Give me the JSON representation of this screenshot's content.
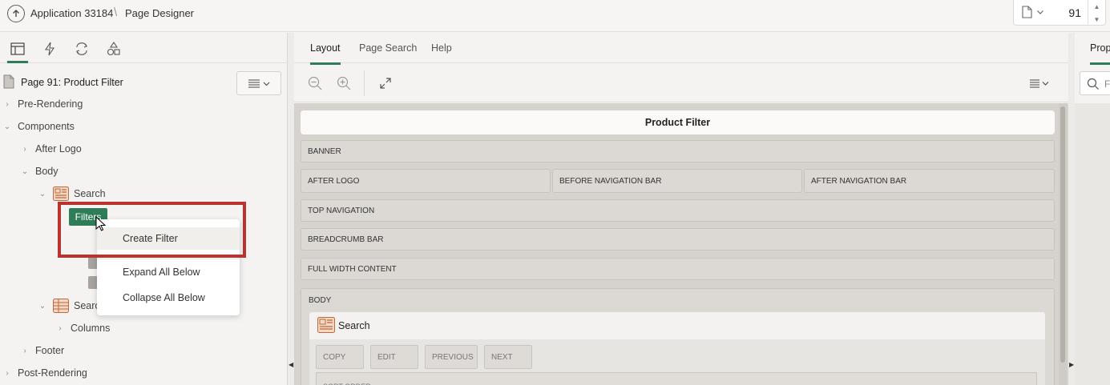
{
  "header": {
    "app_crumb": "Application 33184",
    "separator": "\\",
    "page_crumb": "Page Designer",
    "page_number": "91"
  },
  "left_panel": {
    "tabs": [
      "rendering-tab",
      "dynamic-actions-tab",
      "processing-tab",
      "shared-components-tab"
    ],
    "page_title": "Page 91: Product Filter",
    "tree": {
      "pre_rendering": "Pre-Rendering",
      "components": "Components",
      "after_logo": "After Logo",
      "body": "Body",
      "search": "Search",
      "filters": "Filters",
      "search2": "Searc",
      "columns": "Columns",
      "footer": "Footer",
      "post_rendering": "Post-Rendering"
    },
    "context_menu": {
      "create_filter": "Create Filter",
      "expand_all_below": "Expand All Below",
      "collapse_all_below": "Collapse All Below"
    }
  },
  "center_panel": {
    "tabs": {
      "layout": "Layout",
      "page_search": "Page Search",
      "help": "Help"
    },
    "canvas": {
      "page_title": "Product Filter",
      "banner": "BANNER",
      "after_logo": "AFTER LOGO",
      "before_nav": "BEFORE NAVIGATION BAR",
      "after_nav": "AFTER NAVIGATION BAR",
      "top_nav": "TOP NAVIGATION",
      "breadcrumb_bar": "BREADCRUMB BAR",
      "full_width": "FULL WIDTH CONTENT",
      "body": "BODY",
      "search_region": "Search",
      "copy": "COPY",
      "edit": "EDIT",
      "previous": "PREVIOUS",
      "next": "NEXT",
      "sort_order": "SORT ORDER"
    }
  },
  "right_panel": {
    "tab": "Prop",
    "search_placeholder": "F"
  },
  "colors": {
    "accent": "#2f7d58",
    "highlight_border": "#b9332f"
  }
}
